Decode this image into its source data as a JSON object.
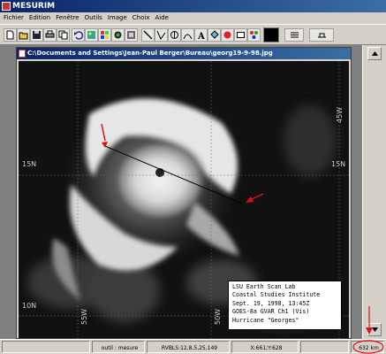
{
  "app": {
    "title": "MESURIM"
  },
  "menu": [
    "Fichier",
    "Edition",
    "Fenêtre",
    "Outils",
    "Image",
    "Choix",
    "Aide"
  ],
  "toolbar": {
    "icons": [
      "new-icon",
      "open-icon",
      "save-icon",
      "print-icon",
      "copy-icon",
      "undo-icon",
      "image-icon",
      "palette-icon",
      "stack-icon",
      "zoom-icon",
      "line-icon",
      "angle-icon",
      "select-icon",
      "curve-icon",
      "text-icon",
      "fill-icon",
      "eraser-icon",
      "rectangle-icon",
      "color-icon",
      "black-swatch",
      "contrast-icon",
      "level-icon"
    ]
  },
  "image_window": {
    "title": "C:\\Documents and Settings\\Jean-Paul Berger\\Bureau\\georg19-9-98.jpg"
  },
  "map": {
    "lat_left": "15N",
    "lat_right": "15N",
    "lat_left_low": "10N",
    "lon_labels": [
      "55W",
      "50W",
      "45W"
    ],
    "label_lines": [
      "LSU Earth Scan Lab",
      "Coastal Studies Institute",
      "Sept. 19, 1998, 13:45Z",
      "GOES-8a GVAR Ch1 (Vis)",
      "Hurricane \"Georges\""
    ]
  },
  "status": {
    "tool": "outil : mesure",
    "rgb": "RVBLS:12,8,5,25,149",
    "coords": "X:661;Y:628",
    "measure": "632 km"
  },
  "annotation_color": "#e01010"
}
